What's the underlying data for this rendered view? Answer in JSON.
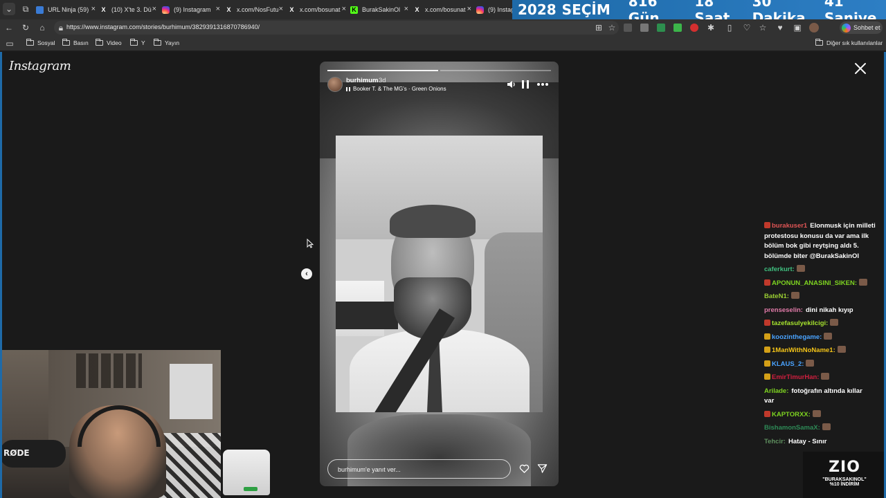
{
  "browser": {
    "tabs": [
      {
        "label": "URL Ninja (59)",
        "fav": "URL-ninja-icon",
        "color": "#3a7bd5"
      },
      {
        "label": "(10) X'te 3. Dü",
        "fav": "x-icon",
        "color": "#000000"
      },
      {
        "label": "(9) Instagram",
        "fav": "instagram-icon",
        "color": "#d6249f"
      },
      {
        "label": "x.com/NosFutu",
        "fav": "x-icon",
        "color": "#000000"
      },
      {
        "label": "x.com/bosunat",
        "fav": "x-icon",
        "color": "#000000"
      },
      {
        "label": "BurakSakinOl",
        "fav": "kick-icon",
        "color": "#53fc18"
      },
      {
        "label": "x.com/bosunat",
        "fav": "x-icon",
        "color": "#000000"
      },
      {
        "label": "(9) Instag",
        "fav": "instagram-icon",
        "color": "#d6249f"
      }
    ],
    "countdown": {
      "year": "2028",
      "label": "SEÇİM",
      "days": "816 Gün",
      "hours": "18 Saat",
      "minutes": "30 Dakika",
      "seconds": "41 Saniye"
    },
    "url": "https://www.instagram.com/stories/burhimum/3829391316870786940/",
    "chat_button": "Sohbet et",
    "bookmarks": [
      "Sosyal",
      "Basın",
      "Video",
      "Y",
      "Yayın"
    ],
    "other_bookmarks": "Diğer sık kullanılanlar"
  },
  "instagram": {
    "logo": "Instagram",
    "story": {
      "username": "burhimum",
      "age": "3d",
      "music": "Booker T. & The MG's · Green Onions",
      "reply_placeholder": "burhimum'e yanıt ver...",
      "progress": [
        1.0,
        0.0
      ]
    }
  },
  "chat": {
    "messages": [
      {
        "user": "burakuser1",
        "text": "Elonmusk için milleti",
        "color": "#e05555",
        "badge": "#c0392b"
      },
      {
        "user": "",
        "text": "protestosu konusu da var ama ilk",
        "color": "#ffffff"
      },
      {
        "user": "",
        "text": "bölüm bok gibi reytşing aldı 5.",
        "color": "#ffffff"
      },
      {
        "user": "",
        "text": "bölümde biter @BurakSakinOl",
        "color": "#ffffff"
      },
      {
        "user": "caferkurt:",
        "text": "",
        "color": "#3fbf7f",
        "emote": true
      },
      {
        "user": "APONUN_ANASINI_SIKEN:",
        "text": "",
        "color": "#7ed321",
        "badge": "#c0392b",
        "emote": true
      },
      {
        "user": "BateN1:",
        "text": "",
        "color": "#9acd32",
        "emote": true
      },
      {
        "user": "prenseselin:",
        "text": "dini nikah kıyıp",
        "color": "#e07aa8"
      },
      {
        "user": "tazefasulyekilcigi:",
        "text": "",
        "color": "#a6e22e",
        "badge": "#c0392b",
        "emote": true
      },
      {
        "user": "koozinthegame:",
        "text": "",
        "color": "#4aa3ff",
        "badge": "#d4a017",
        "emote": true
      },
      {
        "user": "1ManWithNoName1:",
        "text": "",
        "color": "#f5c518",
        "badge": "#d4a017",
        "emote": true
      },
      {
        "user": "KLAUS_2:",
        "text": "",
        "color": "#4aa3ff",
        "badge": "#d4a017",
        "emote": true
      },
      {
        "user": "EmirTimurHan:",
        "text": "",
        "color": "#d11f3f",
        "badge": "#d4a017",
        "emote": true
      },
      {
        "user": "Arilade:",
        "text": "fotoğrafın altında kıllar",
        "color": "#7ed321"
      },
      {
        "user": "",
        "text": "var",
        "color": "#ffffff"
      },
      {
        "user": "KAPTORXX:",
        "text": "",
        "color": "#7ed321",
        "badge": "#c0392b",
        "emote": true
      },
      {
        "user": "BishamonSamaX:",
        "text": "",
        "color": "#2e8b57",
        "emote": true
      },
      {
        "user": "Tehcir:",
        "text": "Hatay - Sınır",
        "color": "#5f8f5f"
      }
    ]
  },
  "webcam": {
    "mic_label": "RØDE"
  },
  "promo": {
    "logo": "ZIO",
    "line1": "\"BURAKSAKINOL\"",
    "line2": "%10 İNDİRİM"
  }
}
